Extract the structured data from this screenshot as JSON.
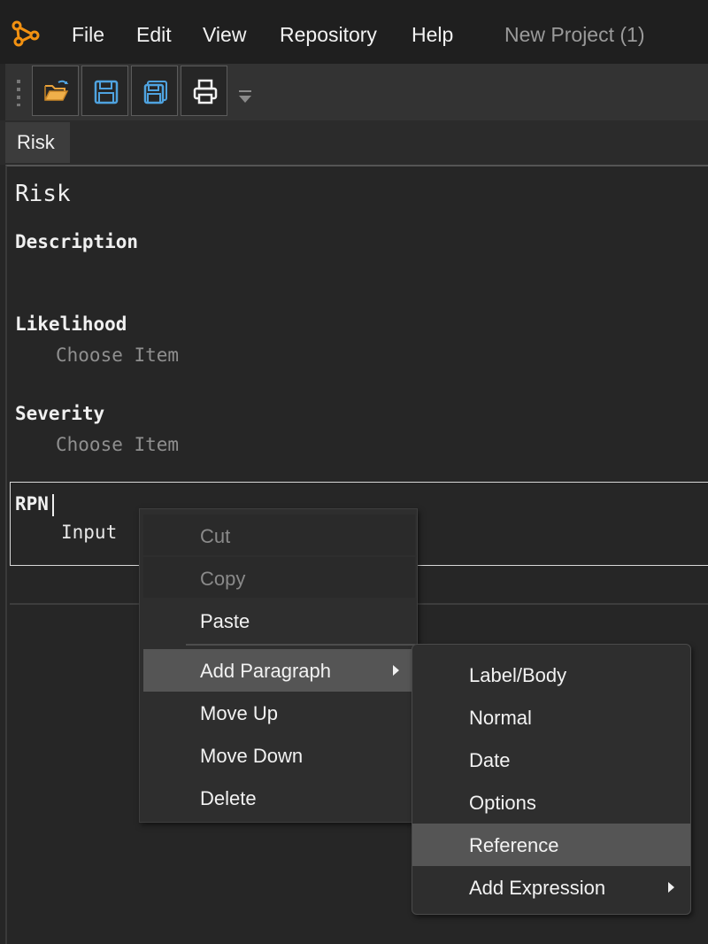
{
  "app": {
    "logo_icon": "graph-nodes-icon",
    "accent": "#f29111"
  },
  "menubar": {
    "items": [
      "File",
      "Edit",
      "View",
      "Repository",
      "Help"
    ],
    "window_title": "New Project (1)"
  },
  "toolbar": {
    "buttons": [
      {
        "name": "open-folder-icon"
      },
      {
        "name": "save-icon"
      },
      {
        "name": "save-all-icon"
      },
      {
        "name": "print-icon"
      }
    ]
  },
  "tabs": [
    {
      "label": "Risk"
    }
  ],
  "document": {
    "title": "Risk",
    "fields": [
      {
        "label": "Description",
        "value": ""
      },
      {
        "label": "Likelihood",
        "value": "Choose Item"
      },
      {
        "label": "Severity",
        "value": "Choose Item"
      },
      {
        "label": "RPN",
        "value": "Input"
      }
    ]
  },
  "context_menu": {
    "items": [
      {
        "label": "Cut",
        "enabled": false
      },
      {
        "label": "Copy",
        "enabled": false
      },
      {
        "label": "Paste",
        "enabled": true
      },
      {
        "label": "Add Paragraph",
        "enabled": true,
        "submenu": true,
        "active": true
      },
      {
        "label": "Move Up",
        "enabled": true
      },
      {
        "label": "Move Down",
        "enabled": true
      },
      {
        "label": "Delete",
        "enabled": true
      }
    ]
  },
  "submenu": {
    "items": [
      {
        "label": "Label/Body"
      },
      {
        "label": "Normal"
      },
      {
        "label": "Date"
      },
      {
        "label": "Options"
      },
      {
        "label": "Reference",
        "active": true
      },
      {
        "label": "Add Expression",
        "submenu": true
      }
    ]
  }
}
